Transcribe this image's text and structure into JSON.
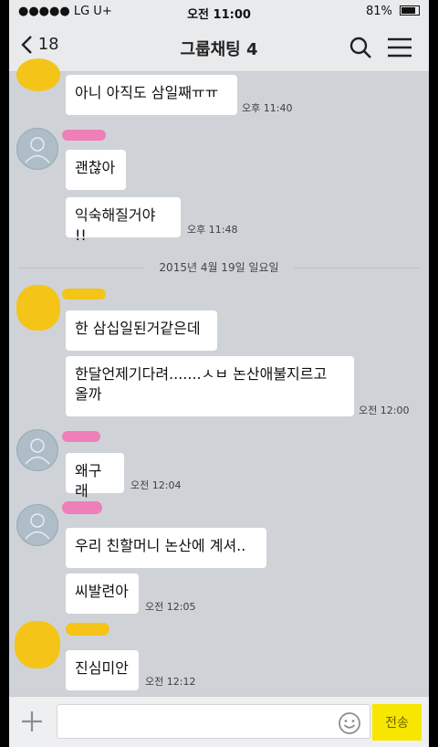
{
  "status_bar": {
    "carrier": "●●●●● LG U+",
    "time": "오전 11:00",
    "battery": "81%",
    "battery_level": 0.81
  },
  "header": {
    "back_count": "18",
    "title": "그룹채팅 4"
  },
  "messages": [
    {
      "text": "아니 아직도 삼일째ㅠㅠ",
      "time": "오후 11:40"
    },
    {
      "text": "괜찮아",
      "time": ""
    },
    {
      "text": "익숙해질거야 !!",
      "time": "오후 11:48"
    },
    {
      "text": "한 삼십일된거같은데",
      "time": ""
    },
    {
      "text_line1": "한달언제기다려.......ㅅㅂ 논산애불지르고",
      "text_line2": "올까",
      "time": "오전 12:00"
    },
    {
      "text": "왜구래",
      "time": "오전 12:04"
    },
    {
      "text": "우리 친할머니 논산에 계셔..",
      "time": ""
    },
    {
      "text": "씨발련아",
      "time": "오전 12:05"
    },
    {
      "text": "진심미안",
      "time": "오전 12:12"
    }
  ],
  "date_separator": "2015년 4월 19일 일요일",
  "input_bar": {
    "placeholder": "",
    "send_label": "전송"
  },
  "colors": {
    "chat_background": "#cfd3d8",
    "send_button": "#f7e600",
    "avatar_blue": "#aebdc8",
    "redaction_pink": "#ee7fb8",
    "redaction_yellow": "#f4c418"
  }
}
